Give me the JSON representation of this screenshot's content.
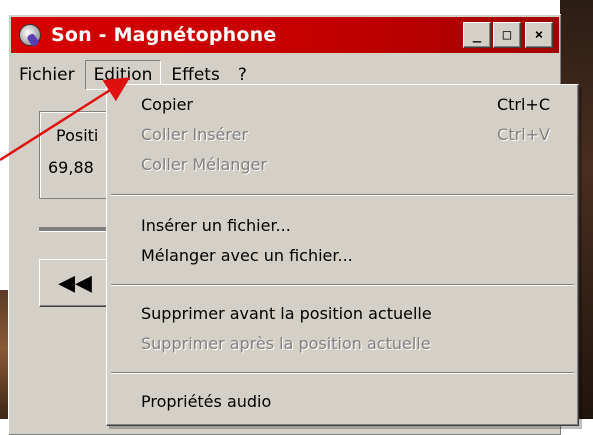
{
  "window": {
    "title": "Son - Magnétophone",
    "buttons": {
      "minimize": "_",
      "maximize": "□",
      "close": "×"
    }
  },
  "menubar": {
    "items": [
      "Fichier",
      "Edition",
      "Effets",
      "?"
    ],
    "active": "Edition"
  },
  "position_panel": {
    "label": "Positi",
    "value": "69,88"
  },
  "rewind_button": {
    "glyph": "◀◀"
  },
  "edition_menu": {
    "items": [
      {
        "label": "Copier",
        "shortcut": "Ctrl+C",
        "enabled": true
      },
      {
        "label": "Coller Insérer",
        "shortcut": "Ctrl+V",
        "enabled": false
      },
      {
        "label": "Coller Mélanger",
        "shortcut": "",
        "enabled": false
      },
      {
        "label": "Insérer un fichier...",
        "shortcut": "",
        "enabled": true
      },
      {
        "label": "Mélanger avec un fichier...",
        "shortcut": "",
        "enabled": true
      },
      {
        "label": "Supprimer avant la position actuelle",
        "shortcut": "",
        "enabled": true
      },
      {
        "label": "Supprimer après la position actuelle",
        "shortcut": "",
        "enabled": false
      },
      {
        "label": "Propriétés audio",
        "shortcut": "",
        "enabled": true
      }
    ]
  },
  "annotation": {
    "arrow_color": "#e01010"
  },
  "colors": {
    "titlebar": "#c80000",
    "face": "#d4d0c8",
    "disabled_text": "#808080"
  }
}
